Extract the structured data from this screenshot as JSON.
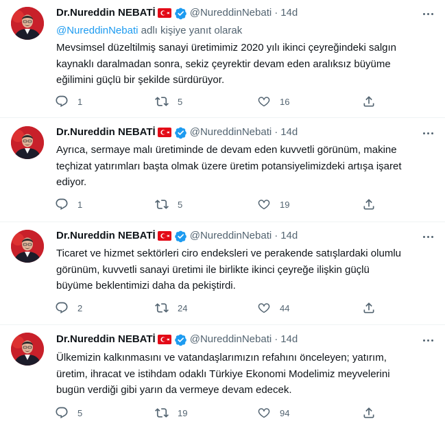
{
  "author": {
    "display_name": "Dr.Nureddin NEBATİ",
    "handle": "@NureddinNebati",
    "flag_icon": "turkey-flag-icon",
    "verified_icon": "verified-badge-icon"
  },
  "colors": {
    "link": "#1d9bf0",
    "secondary_text": "#536471",
    "primary_text": "#0f1419",
    "flag_red": "#e30a17"
  },
  "tweets": [
    {
      "time": "14d",
      "reply_to_mention": "@NureddinNebati",
      "reply_to_suffix": "adlı kişiye yanıt olarak",
      "text": "Mevsimsel düzeltilmiş sanayi üretimimiz 2020 yılı ikinci çeyreğindeki salgın\nkaynaklı daralmadan sonra, sekiz çeyrektir devam eden aralıksız büyüme\neğilimini güçlü bir şekilde sürdürüyor.",
      "replies": "1",
      "retweets": "5",
      "likes": "16"
    },
    {
      "time": "14d",
      "text": "Ayrıca, sermaye malı üretiminde de devam eden kuvvetli görünüm, makine\nteçhizat yatırımları başta olmak üzere üretim potansiyelimizdeki artışa işaret\nediyor.",
      "replies": "1",
      "retweets": "5",
      "likes": "19"
    },
    {
      "time": "14d",
      "text": "Ticaret ve hizmet sektörleri ciro endeksleri ve perakende satışlardaki olumlu\ngörünüm, kuvvetli sanayi üretimi ile birlikte ikinci çeyreğe ilişkin güçlü\nbüyüme beklentimizi daha da pekiştirdi.",
      "replies": "2",
      "retweets": "24",
      "likes": "44"
    },
    {
      "time": "14d",
      "text": "Ülkemizin kalkınmasını ve vatandaşlarımızın refahını önceleyen; yatırım,\nüretim, ihracat ve istihdam odaklı Türkiye Ekonomi Modelimiz meyvelerini\nbugün verdiği gibi yarın da vermeye devam edecek.",
      "replies": "5",
      "retweets": "19",
      "likes": "94"
    }
  ],
  "dot_separator": "·"
}
